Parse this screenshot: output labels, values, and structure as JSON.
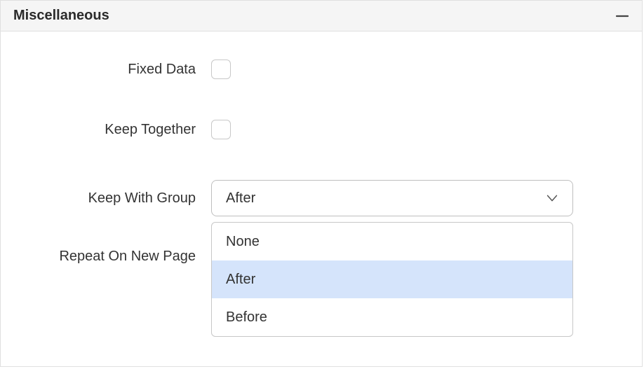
{
  "panel": {
    "title": "Miscellaneous"
  },
  "fields": {
    "fixed_data": {
      "label": "Fixed Data"
    },
    "keep_together": {
      "label": "Keep Together"
    },
    "keep_with_group": {
      "label": "Keep With Group",
      "value": "After",
      "options": [
        "None",
        "After",
        "Before"
      ]
    },
    "repeat_on_new_page": {
      "label": "Repeat On New Page"
    }
  }
}
